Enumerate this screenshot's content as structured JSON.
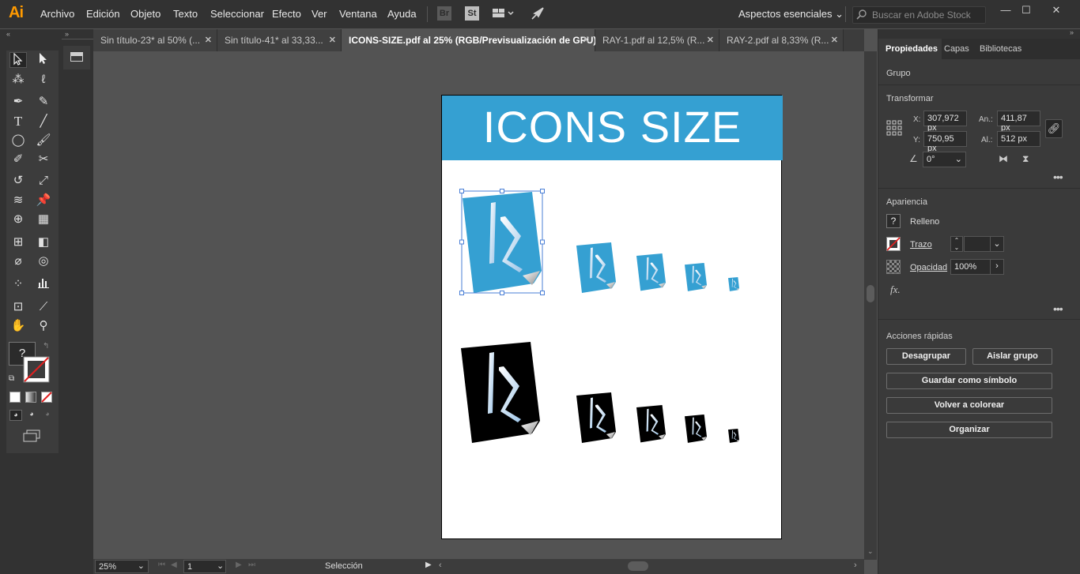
{
  "app": {
    "logo": "Ai"
  },
  "menu": [
    "Archivo",
    "Edición",
    "Objeto",
    "Texto",
    "Seleccionar",
    "Efecto",
    "Ver",
    "Ventana",
    "Ayuda"
  ],
  "toolbar_icons": {
    "bridge": "Br",
    "stock": "St"
  },
  "workspace": {
    "label": "Aspectos esenciales"
  },
  "search": {
    "placeholder": "Buscar en Adobe Stock"
  },
  "tabs": [
    {
      "label": "Sin título-23* al 50% (..."
    },
    {
      "label": "Sin título-41* al 33,33..."
    },
    {
      "label": "ICONS-SIZE.pdf al 25% (RGB/Previsualización de GPU)"
    },
    {
      "label": "RAY-1.pdf al 12,5% (R..."
    },
    {
      "label": "RAY-2.pdf al 8,33% (R..."
    }
  ],
  "artboard": {
    "banner": "ICONS SIZE"
  },
  "status": {
    "zoom": "25%",
    "page": "1",
    "tool": "Selección"
  },
  "colors": {
    "accent_blue": "#35a0d2",
    "logo_orange": "#ff9a00"
  },
  "panel": {
    "tabs": [
      "Propiedades",
      "Capas",
      "Bibliotecas"
    ],
    "group": "Grupo",
    "transform": {
      "title": "Transformar",
      "x_label": "X:",
      "x": "307,972 px",
      "y_label": "Y:",
      "y": "750,95 px",
      "w_label": "An.:",
      "w": "411,87 px",
      "h_label": "Al.:",
      "h": "512 px",
      "angle": "0°"
    },
    "appearance": {
      "title": "Apariencia",
      "fill": "Relleno",
      "fill_value": "?",
      "stroke": "Trazo",
      "opacity": "Opacidad",
      "opacity_value": "100%",
      "fx": "fx."
    },
    "quick_actions": {
      "title": "Acciones rápidas",
      "ungroup": "Desagrupar",
      "isolate": "Aislar grupo",
      "save_symbol": "Guardar como símbolo",
      "recolor": "Volver a colorear",
      "arrange": "Organizar"
    }
  }
}
